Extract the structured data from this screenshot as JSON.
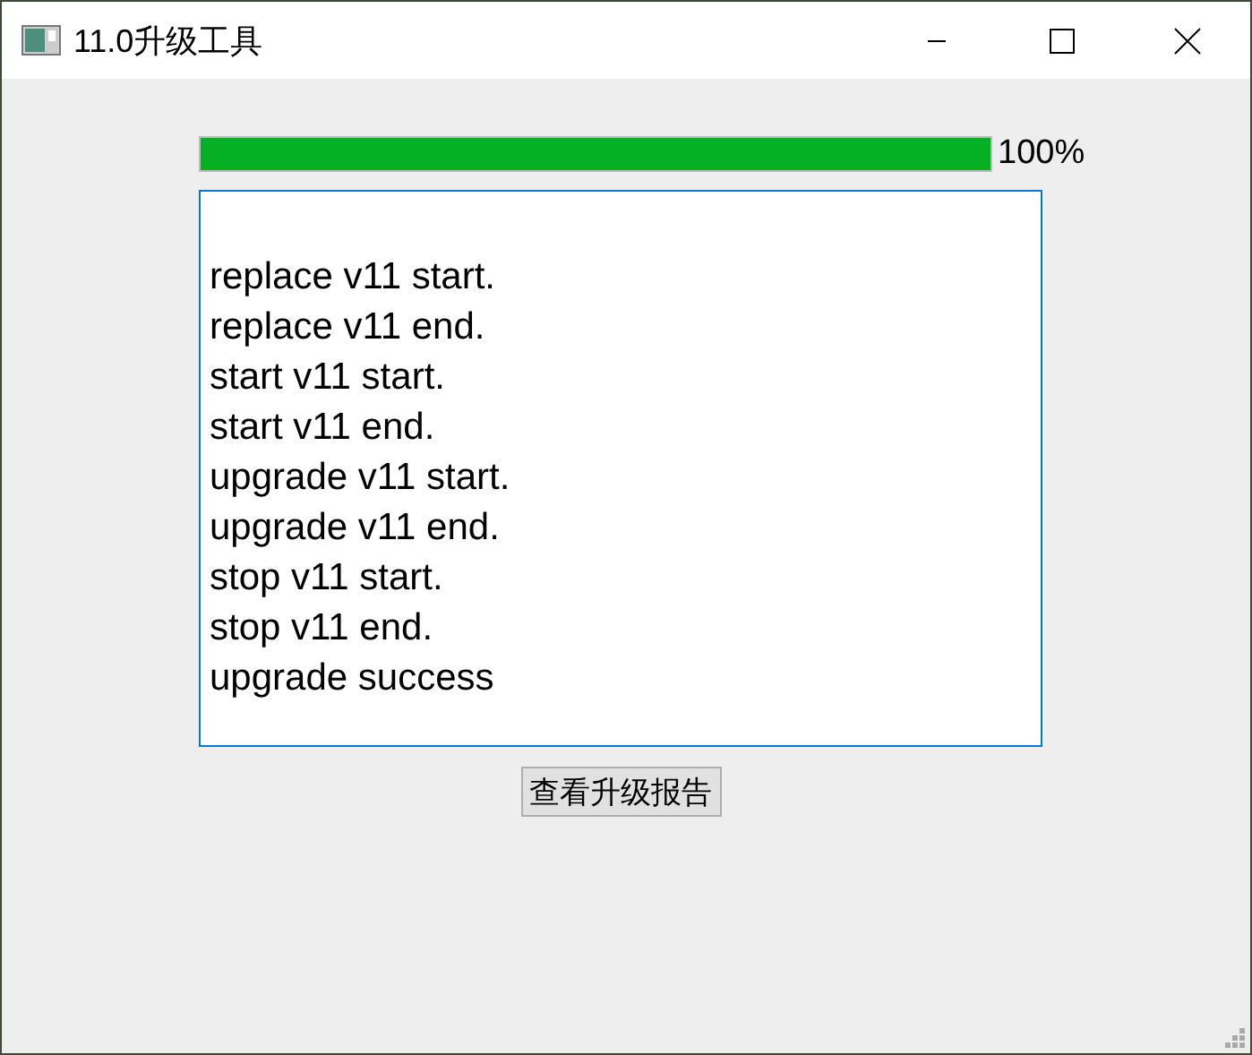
{
  "window": {
    "title": "11.0升级工具"
  },
  "progress": {
    "level": 1,
    "reading": "100%"
  },
  "log": {
    "focused": true,
    "lines": [
      "replace v11 start.",
      "replace v11 end.",
      "start v11 start.",
      "start v11 end.",
      "upgrade v11 start.",
      "upgrade v11 end.",
      "stop v11 start.",
      "stop v11 end.",
      "upgrade success"
    ]
  },
  "buttons": [
    "查看升级报告"
  ]
}
